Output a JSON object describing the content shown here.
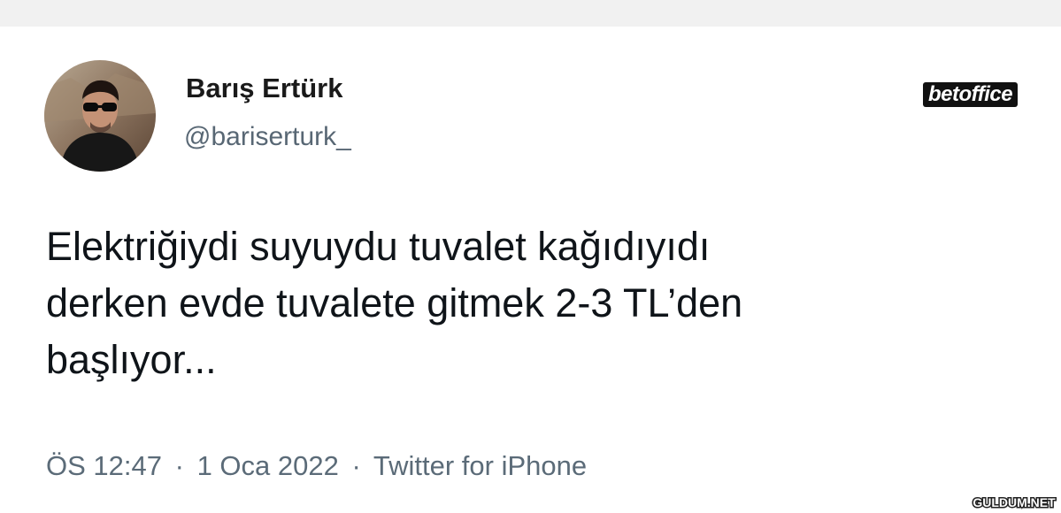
{
  "tweet": {
    "author": {
      "display_name": "Barış Ertürk",
      "handle": "@bariserturk_"
    },
    "text_lines": [
      "Elektriğiydi suyuydu tuvalet kağıdıyıdı",
      "derken evde tuvalete gitmek 2-3 TL’den",
      "başlıyor..."
    ],
    "meta": {
      "time": "ÖS 12:47",
      "separator": "·",
      "date": "1 Oca 2022",
      "source": "Twitter for iPhone"
    }
  },
  "watermarks": {
    "top_right": "betoffice",
    "bottom_right": "GULDUM.NET"
  },
  "colors": {
    "name": "#1a1a1a",
    "handle": "#586774",
    "body_text": "#0f1419",
    "meta_text": "#5b6b78",
    "background": "#ffffff",
    "top_strip": "#f1f1f1"
  }
}
